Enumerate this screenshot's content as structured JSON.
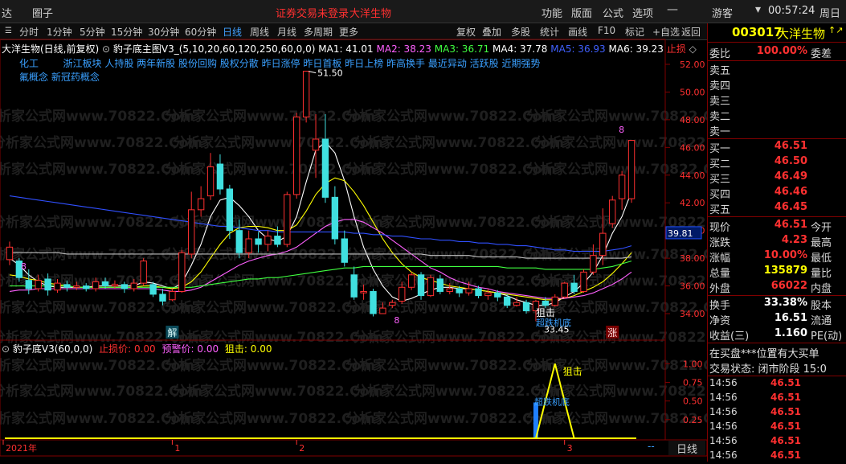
{
  "topbar": {
    "left_clip": "达",
    "circle": "圈子",
    "notice": "证券交易未登录",
    "notice_stock": "大洋生物",
    "menu": [
      "功能",
      "版面",
      "公式",
      "选项"
    ],
    "user": "游客",
    "time": "00:57:24",
    "weekday": "周日"
  },
  "toolbar": {
    "periods": [
      "分时",
      "1分钟",
      "5分钟",
      "15分钟",
      "30分钟",
      "60分钟",
      "日线",
      "周线",
      "月线",
      "多周期",
      "更多"
    ],
    "active_period": "日线",
    "right_buttons": [
      "复权",
      "叠加",
      "多股",
      "统计",
      "画线",
      "F10",
      "标记",
      "+自选",
      "返回"
    ]
  },
  "chart_header": {
    "title": "大洋生物(日线,前复权)",
    "indicator": "豹子底主图V3_(5,10,20,60,120,250,60,0,0)",
    "ma": [
      {
        "label": "MA1: 41.01",
        "color": "#ffffff"
      },
      {
        "label": "MA2: 38.23",
        "color": "#ff60ff"
      },
      {
        "label": "MA3: 36.71",
        "color": "#40ff40"
      },
      {
        "label": "MA4: 37.78",
        "color": "#ffffff"
      },
      {
        "label": "MA5: 36.93",
        "color": "#4060ff"
      },
      {
        "label": "MA6: 39.23",
        "color": "#ffffff"
      }
    ],
    "stop": "止损"
  },
  "concepts_line1": "化工        浙江板块 人持股 两年新股 股份回购 股权分散 昨日涨停 昨日首板 昨日上榜 昨高换手 最近异动 活跃股 近期强势",
  "concepts_line2": "氟概念 新冠药概念",
  "main_axis": [
    "52.00",
    "50.00",
    "48.00",
    "46.00",
    "44.00",
    "42.00",
    "40.00",
    "38.00",
    "36.00",
    "34.00"
  ],
  "price_marker": "39.81",
  "annotations": {
    "high": "51.50",
    "low": "33.45",
    "sniper": "狙击",
    "rebound": "超跌机底",
    "jie": "解",
    "zhang": "涨",
    "eight_a": "8",
    "eight_b": "8",
    "eight_c": "8"
  },
  "sub_header": {
    "name": "豹子底V3(60,0,0)",
    "stop_loss": "止损价: 0.00",
    "warn": "预警价: 0.00",
    "sniper": "狙击: 0.00"
  },
  "sub_axis": [
    "1.00",
    "0.75",
    "0.50",
    "0.25"
  ],
  "sub_labels": {
    "sniper": "狙击",
    "rebound": "超跌机底"
  },
  "time_axis": [
    "2021年",
    "1",
    "2",
    "3"
  ],
  "bottom_tab": "日线",
  "bottom_dash": "--",
  "watermark": "分析家公式网www.70822.Com",
  "quote": {
    "code": "003017",
    "name": "大洋生物",
    "weibi_label": "委比",
    "weibi_value": "100.00%",
    "weicha_label": "委差",
    "asks": [
      "卖五",
      "卖四",
      "卖三",
      "卖二",
      "卖一"
    ],
    "bids": [
      {
        "label": "买一",
        "price": "46.51"
      },
      {
        "label": "买二",
        "price": "46.50"
      },
      {
        "label": "买三",
        "price": "46.49"
      },
      {
        "label": "买四",
        "price": "46.46"
      },
      {
        "label": "买五",
        "price": "46.45"
      }
    ],
    "stats": [
      {
        "label": "现价",
        "value": "46.51",
        "label2": "今开",
        "color": "#ff3030"
      },
      {
        "label": "涨跌",
        "value": "4.23",
        "label2": "最高",
        "color": "#ff3030"
      },
      {
        "label": "涨幅",
        "value": "10.00%",
        "label2": "最低",
        "color": "#ff3030"
      },
      {
        "label": "总量",
        "value": "135879",
        "label2": "量比",
        "color": "#ffff00"
      },
      {
        "label": "外盘",
        "value": "66022",
        "label2": "内盘",
        "color": "#ff3030"
      }
    ],
    "stats2": [
      {
        "label": "换手",
        "value": "33.38%",
        "label2": "股本",
        "color": "#ffffff"
      },
      {
        "label": "净资",
        "value": "16.51",
        "label2": "流通",
        "color": "#ffffff"
      },
      {
        "label": "收益(三)",
        "value": "1.160",
        "label2": "PE(动)",
        "color": "#ffffff"
      }
    ],
    "notice1": "在买盘***位置有大买单",
    "notice2": "交易状态: 闭市阶段 15:0",
    "ticks": [
      {
        "time": "14:56",
        "price": "46.51"
      },
      {
        "time": "14:56",
        "price": "46.51"
      },
      {
        "time": "14:56",
        "price": "46.51"
      },
      {
        "time": "14:56",
        "price": "46.51"
      },
      {
        "time": "14:56",
        "price": "46.51"
      },
      {
        "time": "14:56",
        "price": "46.51"
      }
    ]
  },
  "chart_data": {
    "type": "candlestick",
    "ylim": [
      33,
      53
    ],
    "candles": [
      {
        "o": 37.9,
        "c": 38.8,
        "h": 39.2,
        "l": 37.5
      },
      {
        "o": 37.8,
        "c": 36.6,
        "h": 38.0,
        "l": 36.3
      },
      {
        "o": 36.4,
        "c": 35.8,
        "h": 37.2,
        "l": 35.4
      },
      {
        "o": 35.8,
        "c": 36.4,
        "h": 36.8,
        "l": 35.6
      },
      {
        "o": 36.5,
        "c": 35.7,
        "h": 36.9,
        "l": 35.3
      },
      {
        "o": 35.7,
        "c": 36.2,
        "h": 36.5,
        "l": 35.5
      },
      {
        "o": 36.1,
        "c": 35.9,
        "h": 36.4,
        "l": 35.6
      },
      {
        "o": 35.9,
        "c": 36.0,
        "h": 36.3,
        "l": 35.7
      },
      {
        "o": 36.0,
        "c": 35.8,
        "h": 36.2,
        "l": 35.6
      },
      {
        "o": 35.8,
        "c": 36.3,
        "h": 36.6,
        "l": 35.6
      },
      {
        "o": 36.3,
        "c": 36.0,
        "h": 36.6,
        "l": 35.8
      },
      {
        "o": 36.0,
        "c": 36.1,
        "h": 36.4,
        "l": 35.8
      },
      {
        "o": 36.1,
        "c": 35.8,
        "h": 36.3,
        "l": 35.5
      },
      {
        "o": 35.8,
        "c": 36.2,
        "h": 36.5,
        "l": 35.6
      },
      {
        "o": 36.2,
        "c": 37.8,
        "h": 38.0,
        "l": 36.0
      },
      {
        "o": 36.1,
        "c": 35.4,
        "h": 36.3,
        "l": 35.2
      },
      {
        "o": 35.4,
        "c": 34.9,
        "h": 35.8,
        "l": 34.6
      },
      {
        "o": 35.0,
        "c": 35.6,
        "h": 35.8,
        "l": 34.9
      },
      {
        "o": 35.6,
        "c": 38.4,
        "h": 38.6,
        "l": 35.5
      },
      {
        "o": 38.3,
        "c": 41.5,
        "h": 42.8,
        "l": 38.0
      },
      {
        "o": 41.5,
        "c": 42.3,
        "h": 43.2,
        "l": 41.0
      },
      {
        "o": 42.5,
        "c": 44.6,
        "h": 45.6,
        "l": 42.2
      },
      {
        "o": 44.8,
        "c": 43.0,
        "h": 45.5,
        "l": 42.6
      },
      {
        "o": 43.0,
        "c": 40.0,
        "h": 43.3,
        "l": 39.4
      },
      {
        "o": 40.0,
        "c": 38.4,
        "h": 40.8,
        "l": 38.0
      },
      {
        "o": 38.4,
        "c": 39.4,
        "h": 40.0,
        "l": 38.0
      },
      {
        "o": 39.4,
        "c": 39.0,
        "h": 39.9,
        "l": 38.4
      },
      {
        "o": 39.0,
        "c": 39.6,
        "h": 40.0,
        "l": 38.5
      },
      {
        "o": 39.6,
        "c": 39.0,
        "h": 40.3,
        "l": 38.8
      },
      {
        "o": 39.0,
        "c": 42.6,
        "h": 42.8,
        "l": 38.8
      },
      {
        "o": 42.6,
        "c": 48.2,
        "h": 48.5,
        "l": 42.3
      },
      {
        "o": 48.2,
        "c": 51.5,
        "h": 51.5,
        "l": 47.8
      },
      {
        "o": 45.8,
        "c": 46.6,
        "h": 48.4,
        "l": 43.8
      },
      {
        "o": 46.6,
        "c": 42.4,
        "h": 48.4,
        "l": 42.0
      },
      {
        "o": 42.4,
        "c": 39.4,
        "h": 43.2,
        "l": 39.0
      },
      {
        "o": 39.4,
        "c": 37.7,
        "h": 40.0,
        "l": 37.4
      },
      {
        "o": 36.8,
        "c": 35.2,
        "h": 37.4,
        "l": 35.0
      },
      {
        "o": 35.5,
        "c": 35.6,
        "h": 36.1,
        "l": 35.0
      },
      {
        "o": 35.6,
        "c": 34.0,
        "h": 35.8,
        "l": 33.8
      },
      {
        "o": 34.0,
        "c": 34.4,
        "h": 34.8,
        "l": 34.0
      },
      {
        "o": 34.6,
        "c": 34.8,
        "h": 35.0,
        "l": 34.4
      },
      {
        "o": 34.9,
        "c": 35.9,
        "h": 36.3,
        "l": 34.7
      },
      {
        "o": 35.9,
        "c": 36.8,
        "h": 37.0,
        "l": 35.7
      },
      {
        "o": 36.8,
        "c": 35.3,
        "h": 37.0,
        "l": 35.0
      },
      {
        "o": 35.3,
        "c": 36.6,
        "h": 36.8,
        "l": 35.2
      },
      {
        "o": 36.5,
        "c": 35.6,
        "h": 36.8,
        "l": 35.4
      },
      {
        "o": 35.6,
        "c": 35.8,
        "h": 36.2,
        "l": 35.4
      },
      {
        "o": 35.8,
        "c": 35.5,
        "h": 36.0,
        "l": 35.2
      },
      {
        "o": 35.5,
        "c": 35.8,
        "h": 36.3,
        "l": 35.3
      },
      {
        "o": 35.8,
        "c": 35.3,
        "h": 36.0,
        "l": 35.1
      },
      {
        "o": 35.3,
        "c": 35.5,
        "h": 35.8,
        "l": 35.0
      },
      {
        "o": 35.5,
        "c": 35.2,
        "h": 35.7,
        "l": 34.9
      },
      {
        "o": 35.2,
        "c": 34.6,
        "h": 35.4,
        "l": 34.4
      },
      {
        "o": 34.6,
        "c": 34.8,
        "h": 35.2,
        "l": 34.5
      },
      {
        "o": 34.8,
        "c": 34.2,
        "h": 35.0,
        "l": 34.0
      },
      {
        "o": 34.2,
        "c": 34.9,
        "h": 35.0,
        "l": 33.45
      },
      {
        "o": 34.9,
        "c": 34.6,
        "h": 35.2,
        "l": 34.4
      },
      {
        "o": 34.6,
        "c": 35.2,
        "h": 35.4,
        "l": 34.5
      },
      {
        "o": 35.2,
        "c": 36.2,
        "h": 36.3,
        "l": 35.1
      },
      {
        "o": 36.2,
        "c": 35.6,
        "h": 36.8,
        "l": 35.4
      },
      {
        "o": 35.6,
        "c": 37.0,
        "h": 37.2,
        "l": 35.5
      },
      {
        "o": 37.0,
        "c": 38.2,
        "h": 39.0,
        "l": 36.8
      },
      {
        "o": 38.2,
        "c": 39.8,
        "h": 41.6,
        "l": 37.5
      },
      {
        "o": 40.5,
        "c": 42.2,
        "h": 42.5,
        "l": 40.2
      },
      {
        "o": 42.3,
        "c": 44.0,
        "h": 44.3,
        "l": 41.5
      },
      {
        "o": 42.3,
        "c": 46.51,
        "h": 46.51,
        "l": 42.0
      }
    ],
    "ma_lines": [
      {
        "name": "MA1",
        "color": "#ffffff",
        "values": [
          38.0,
          37.5,
          36.8,
          36.3,
          36.0,
          35.9,
          35.9,
          35.9,
          35.9,
          36.0,
          36.0,
          36.0,
          36.0,
          36.0,
          36.3,
          36.2,
          36.0,
          35.8,
          36.2,
          37.5,
          39.0,
          41.0,
          42.2,
          42.4,
          41.8,
          41.0,
          40.0,
          39.4,
          39.2,
          39.6,
          41.0,
          43.5,
          45.8,
          46.4,
          45.6,
          43.6,
          41.0,
          38.8,
          37.2,
          36.0,
          35.2,
          34.9,
          35.1,
          35.4,
          35.7,
          35.9,
          35.9,
          35.8,
          35.8,
          35.7,
          35.6,
          35.5,
          35.3,
          35.0,
          34.8,
          34.6,
          34.6,
          34.8,
          35.2,
          35.6,
          36.2,
          37.0,
          38.2,
          39.8,
          41.0,
          42.8
        ]
      },
      {
        "name": "MA2",
        "color": "#ffff00",
        "values": [
          36.8,
          36.7,
          36.5,
          36.4,
          36.2,
          36.1,
          36.0,
          35.9,
          35.9,
          35.9,
          35.9,
          35.9,
          35.9,
          35.9,
          36.0,
          36.0,
          35.9,
          35.8,
          35.9,
          36.3,
          37.0,
          38.0,
          39.0,
          39.8,
          40.2,
          40.3,
          40.3,
          40.2,
          40.0,
          40.0,
          40.4,
          41.4,
          42.6,
          43.4,
          43.8,
          43.6,
          42.8,
          41.8,
          40.6,
          39.4,
          38.4,
          37.6,
          37.0,
          36.6,
          36.4,
          36.2,
          36.0,
          35.9,
          35.8,
          35.7,
          35.6,
          35.5,
          35.4,
          35.3,
          35.2,
          35.1,
          35.0,
          35.0,
          35.1,
          35.3,
          35.6,
          35.9,
          36.3,
          36.9,
          37.6,
          38.4
        ]
      },
      {
        "name": "MA3",
        "color": "#ff60ff",
        "values": [
          35.6,
          35.7,
          35.7,
          35.8,
          35.8,
          35.8,
          35.8,
          35.8,
          35.8,
          35.8,
          35.8,
          35.8,
          35.8,
          35.8,
          35.8,
          35.8,
          35.7,
          35.6,
          35.6,
          35.7,
          35.9,
          36.3,
          36.7,
          37.1,
          37.5,
          37.8,
          38.0,
          38.2,
          38.3,
          38.5,
          38.8,
          39.3,
          39.8,
          40.3,
          40.6,
          40.8,
          40.8,
          40.6,
          40.2,
          39.8,
          39.3,
          38.8,
          38.3,
          37.8,
          37.3,
          37.0,
          36.6,
          36.3,
          36.1,
          35.9,
          35.8,
          35.6,
          35.5,
          35.4,
          35.3,
          35.2,
          35.1,
          35.1,
          35.1,
          35.2,
          35.3,
          35.5,
          35.8,
          36.1,
          36.5,
          37.0
        ]
      },
      {
        "name": "MA4",
        "color": "#40ff40",
        "values": [
          36.0,
          36.0,
          36.0,
          36.0,
          36.0,
          36.0,
          36.0,
          35.9,
          35.9,
          35.9,
          35.9,
          35.9,
          35.9,
          35.9,
          35.9,
          35.9,
          35.9,
          35.9,
          35.9,
          35.9,
          36.0,
          36.1,
          36.2,
          36.3,
          36.4,
          36.5,
          36.5,
          36.6,
          36.6,
          36.7,
          36.8,
          36.9,
          37.0,
          37.1,
          37.2,
          37.3,
          37.3,
          37.4,
          37.4,
          37.4,
          37.4,
          37.4,
          37.4,
          37.4,
          37.4,
          37.4,
          37.4,
          37.4,
          37.4,
          37.4,
          37.4,
          37.4,
          37.3,
          37.3,
          37.3,
          37.3,
          37.2,
          37.2,
          37.2,
          37.2,
          37.2,
          37.2,
          37.3,
          37.4,
          37.6,
          37.8
        ]
      },
      {
        "name": "MA5",
        "color": "#3050ff",
        "values": [
          42.5,
          42.4,
          42.3,
          42.2,
          42.1,
          42.0,
          41.9,
          41.8,
          41.7,
          41.6,
          41.5,
          41.4,
          41.3,
          41.2,
          41.1,
          41.0,
          40.9,
          40.8,
          40.7,
          40.6,
          40.5,
          40.4,
          40.3,
          40.3,
          40.2,
          40.1,
          40.0,
          40.0,
          39.9,
          39.9,
          39.9,
          39.9,
          39.9,
          39.9,
          39.9,
          39.9,
          39.8,
          39.8,
          39.7,
          39.7,
          39.6,
          39.6,
          39.5,
          39.4,
          39.4,
          39.3,
          39.3,
          39.2,
          39.2,
          39.1,
          39.1,
          39.0,
          39.0,
          38.9,
          38.9,
          38.8,
          38.7,
          38.6,
          38.6,
          38.5,
          38.5,
          38.5,
          38.5,
          38.6,
          38.7,
          38.9
        ]
      },
      {
        "name": "MA6",
        "color": "#c0c0c0",
        "values": [
          38.4,
          38.4,
          38.4,
          38.4,
          38.4,
          38.4,
          38.3,
          38.3,
          38.3,
          38.3,
          38.3,
          38.3,
          38.3,
          38.3,
          38.3,
          38.3,
          38.3,
          38.3,
          38.3,
          38.3,
          38.3,
          38.3,
          38.3,
          38.3,
          38.3,
          38.3,
          38.3,
          38.3,
          38.3,
          38.3,
          38.3,
          38.3,
          38.3,
          38.3,
          38.3,
          38.3,
          38.3,
          38.3,
          38.3,
          38.3,
          38.3,
          38.3,
          38.3,
          38.3,
          38.2,
          38.2,
          38.2,
          38.2,
          38.2,
          38.1,
          38.1,
          38.1,
          38.1,
          38.1,
          38.0,
          38.0,
          38.0,
          38.0,
          38.0,
          38.0,
          38.0,
          38.0,
          38.0,
          38.0,
          38.0,
          38.1
        ]
      }
    ],
    "sub_ylim": [
      0,
      1.1
    ],
    "sub_bar": {
      "index": 55,
      "value": 0.48,
      "color": "#2080ff"
    },
    "sub_line": {
      "color": "#ffff00",
      "points": [
        {
          "i": 55,
          "v": 0.0
        },
        {
          "i": 57,
          "v": 1.0
        },
        {
          "i": 59,
          "v": 0.0
        }
      ]
    }
  }
}
